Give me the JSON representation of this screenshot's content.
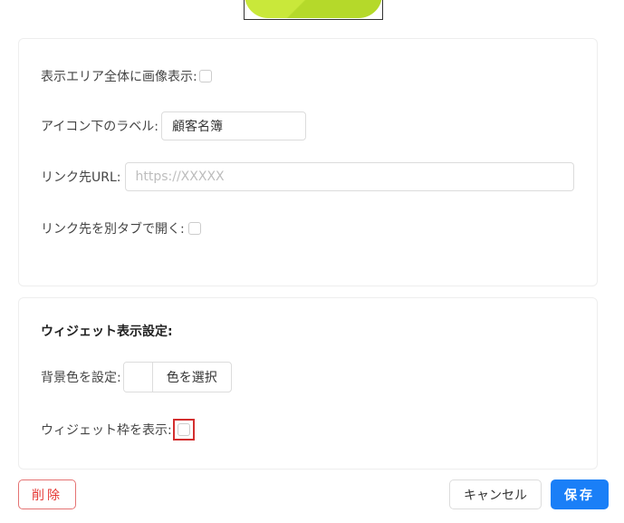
{
  "display": {
    "fullscreen_label": "表示エリア全体に画像表示:",
    "icon_label_label": "アイコン下のラベル:",
    "icon_label_value": "顧客名簿",
    "link_url_label": "リンク先URL:",
    "link_url_placeholder": "https://XXXXX",
    "new_tab_label": "リンク先を別タブで開く:"
  },
  "widget": {
    "title": "ウィジェット表示設定:",
    "bg_color_label": "背景色を設定:",
    "choose_color_label": "色を選択",
    "show_frame_label": "ウィジェット枠を表示:"
  },
  "footer": {
    "delete_label": "削除",
    "cancel_label": "キャンセル",
    "save_label": "保存"
  }
}
